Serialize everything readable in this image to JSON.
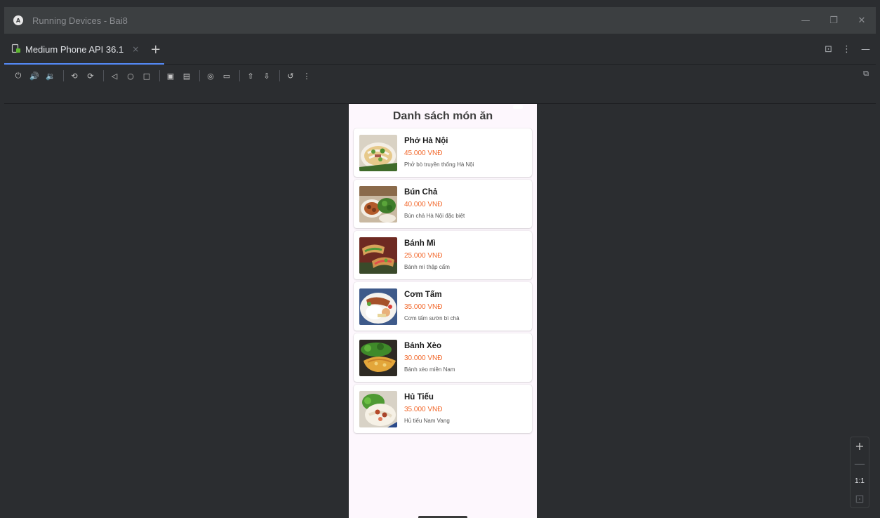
{
  "window": {
    "title": "Running Devices - Bai8",
    "logo_glyph": "A",
    "minimize": "—",
    "restore": "❐",
    "close": "✕"
  },
  "tabs": [
    {
      "label": "Medium Phone API 36.1",
      "close": "×"
    }
  ],
  "tab_add": "+",
  "tab_actions": {
    "embed": "⊡",
    "more": "⋮",
    "hide": "—"
  },
  "toolbar": {
    "buttons": [
      {
        "name": "power-icon",
        "glyph": "⏻"
      },
      {
        "name": "volume-up-icon",
        "glyph": "🔊"
      },
      {
        "name": "volume-down-icon",
        "glyph": "🔉"
      },
      {
        "name": "rotate-left-icon",
        "glyph": "⟲"
      },
      {
        "name": "rotate-right-icon",
        "glyph": "⟳"
      },
      {
        "name": "back-icon",
        "glyph": "◁"
      },
      {
        "name": "home-icon",
        "glyph": "○"
      },
      {
        "name": "overview-icon",
        "glyph": "□"
      },
      {
        "name": "device-frame-icon",
        "glyph": "▣"
      },
      {
        "name": "mirror-icon",
        "glyph": "▤"
      },
      {
        "name": "screenshot-icon",
        "glyph": "◎"
      },
      {
        "name": "screen-record-icon",
        "glyph": "▭"
      },
      {
        "name": "upload-icon",
        "glyph": "⇧"
      },
      {
        "name": "download-icon",
        "glyph": "⇩"
      },
      {
        "name": "reset-icon",
        "glyph": "↺"
      },
      {
        "name": "more-icon",
        "glyph": "⋮"
      }
    ],
    "right_icon": "⧉"
  },
  "app": {
    "title": "Danh sách món ăn",
    "foods": [
      {
        "name": "Phở Hà Nội",
        "price": "45.000 VNĐ",
        "desc": "Phở bò truyền thống Hà Nội"
      },
      {
        "name": "Bún Chả",
        "price": "40.000 VNĐ",
        "desc": "Bún chả Hà Nội đặc biệt"
      },
      {
        "name": "Bánh Mì",
        "price": "25.000 VNĐ",
        "desc": "Bánh mì thập cẩm"
      },
      {
        "name": "Cơm Tấm",
        "price": "35.000 VNĐ",
        "desc": "Cơm tấm sườn bì chả"
      },
      {
        "name": "Bánh Xèo",
        "price": "30.000 VNĐ",
        "desc": "Bánh xèo miền Nam"
      },
      {
        "name": "Hủ Tiếu",
        "price": "35.000 VNĐ",
        "desc": "Hủ tiếu Nam Vang"
      }
    ]
  },
  "zoom": {
    "in": "+",
    "out": "—",
    "actual": "1:1",
    "fit": "⊡"
  },
  "colors": {
    "accent": "#548af7",
    "price": "#f2672a",
    "phone_bg": "#fdf7fd"
  }
}
